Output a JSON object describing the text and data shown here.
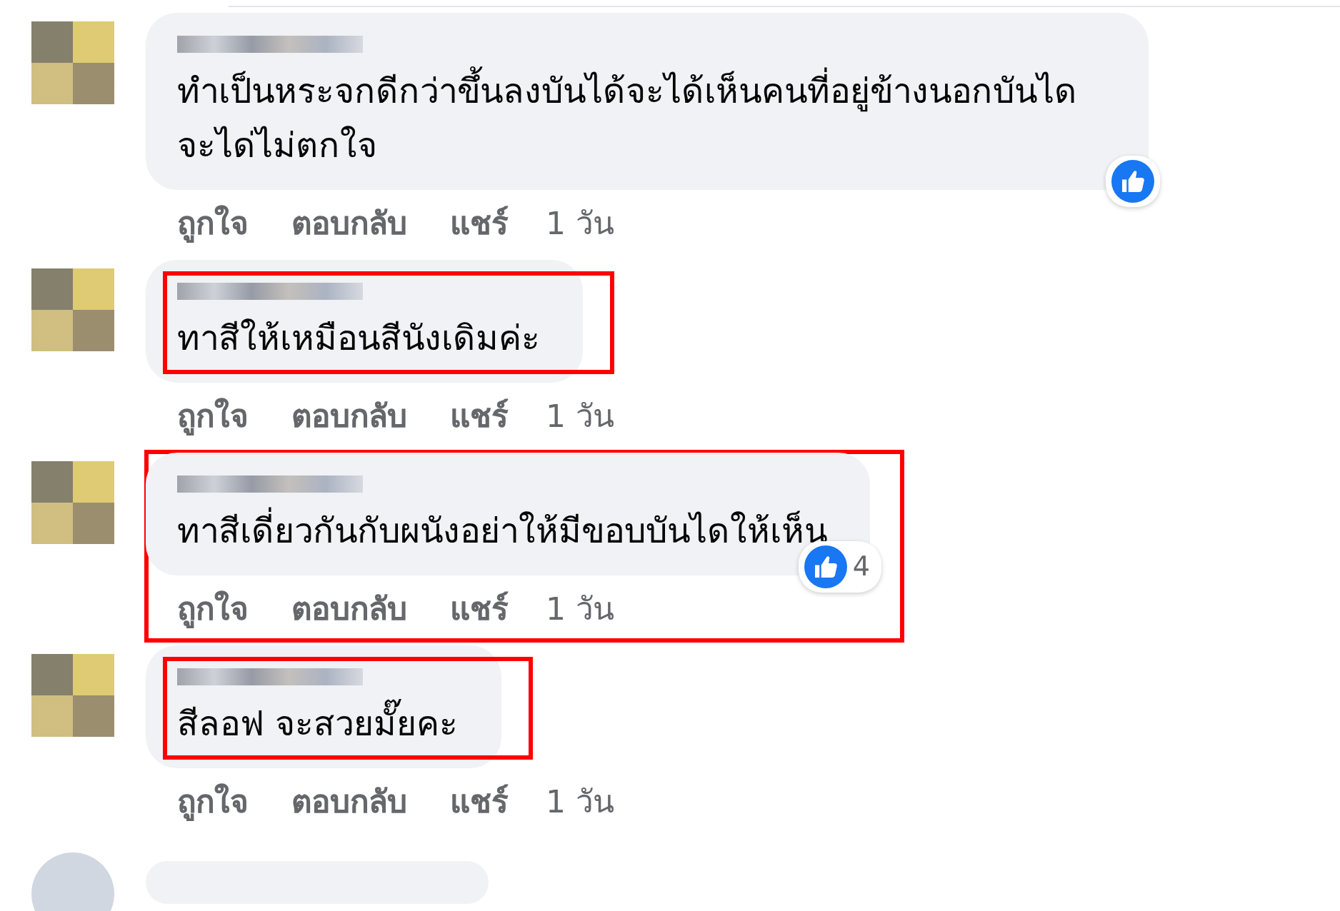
{
  "comments": [
    {
      "text": "ทำเป็นหระจกดีกว่าขึ้นลงบันได้จะได้เห็นคนที่อยู่ข้างนอกบันได จะได่ไม่ตกใจ",
      "bubble_boxed": false,
      "comment_boxed": false,
      "reaction": {
        "kind": "like"
      },
      "actions": [
        "ถูกใจ",
        "ตอบกลับ",
        "แชร์"
      ],
      "time": "1 วัน"
    },
    {
      "text": "ทาสีให้เหมือนสีนังเดิมค่ะ",
      "bubble_boxed": true,
      "comment_boxed": false,
      "actions": [
        "ถูกใจ",
        "ตอบกลับ",
        "แชร์"
      ],
      "time": "1 วัน"
    },
    {
      "text": "ทาสีเดี่ยวกันกับผนังอย่าให้มีขอบบันไดให้เห็น",
      "bubble_boxed": false,
      "comment_boxed": true,
      "reaction": {
        "kind": "like",
        "count": "4"
      },
      "actions": [
        "ถูกใจ",
        "ตอบกลับ",
        "แชร์"
      ],
      "time": "1 วัน"
    },
    {
      "text": "สีลอฟ จะสวยมั๊ยคะ",
      "bubble_boxed": true,
      "comment_boxed": false,
      "actions": [
        "ถูกใจ",
        "ตอบกลับ",
        "แชร์"
      ],
      "time": "1 วัน"
    }
  ]
}
